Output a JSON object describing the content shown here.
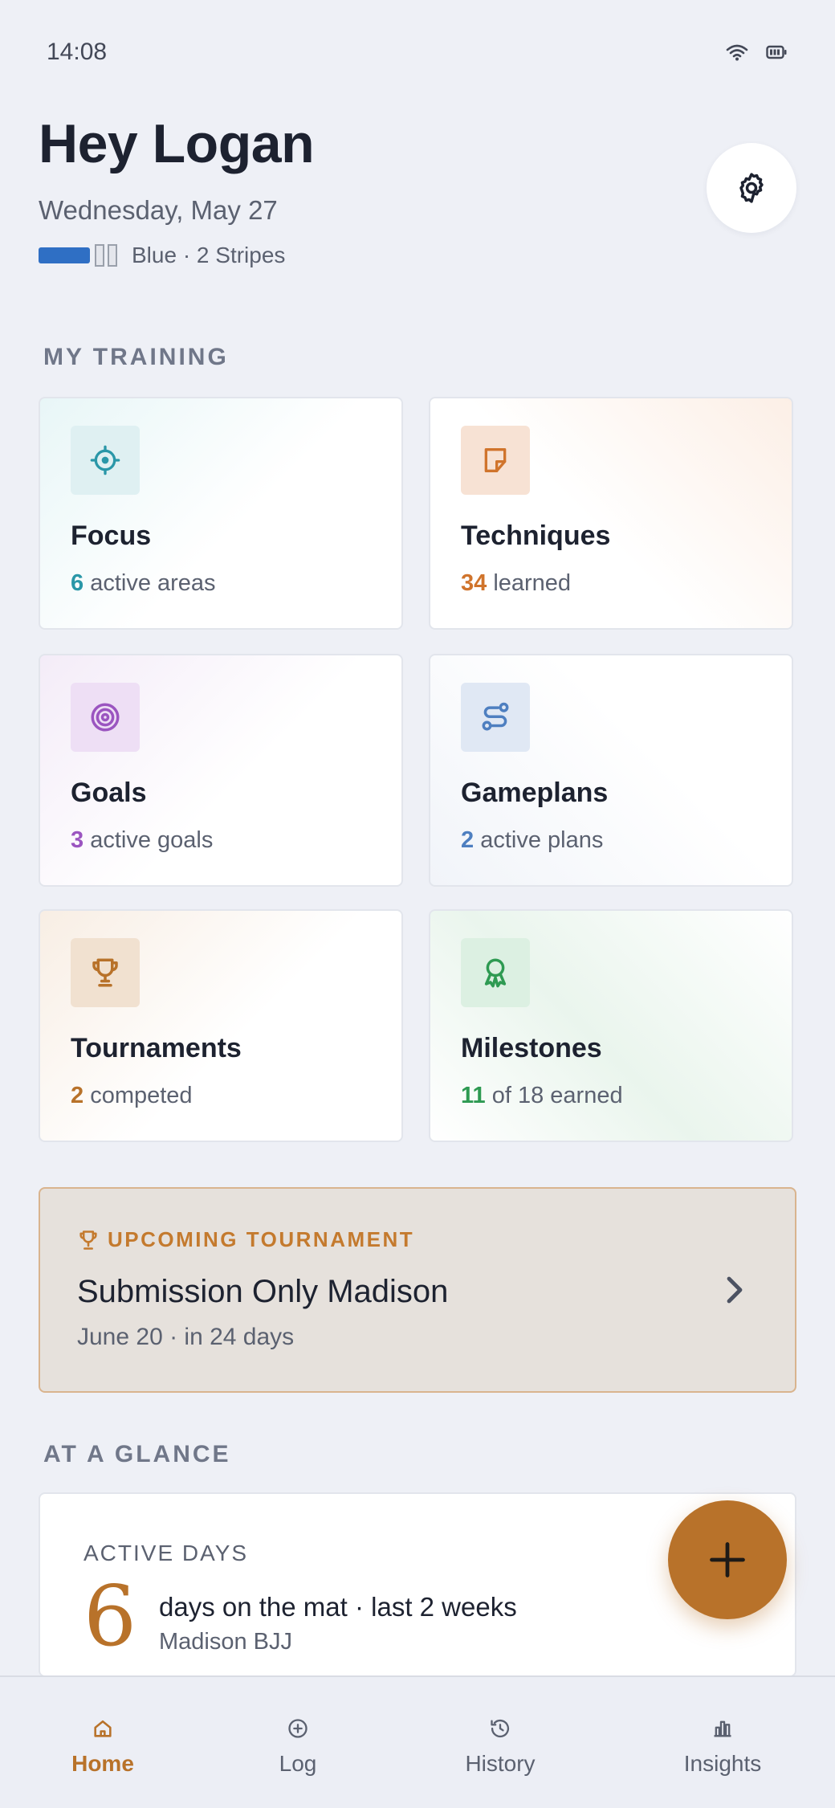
{
  "status": {
    "time": "14:08"
  },
  "header": {
    "greeting": "Hey Logan",
    "date": "Wednesday, May 27",
    "belt_text": "Blue · 2 Stripes"
  },
  "sections": {
    "training_title": "MY TRAINING",
    "glance_title": "AT A GLANCE"
  },
  "cards": [
    {
      "title": "Focus",
      "count": "6",
      "rest": " active areas",
      "accent": "#2a97a8",
      "icon": "crosshair-icon"
    },
    {
      "title": "Techniques",
      "count": "34",
      "rest": " learned",
      "accent": "#d0742c",
      "icon": "sticky-note-icon"
    },
    {
      "title": "Goals",
      "count": "3",
      "rest": " active goals",
      "accent": "#9b55c0",
      "icon": "target-icon"
    },
    {
      "title": "Gameplans",
      "count": "2",
      "rest": " active plans",
      "accent": "#4e7fc0",
      "icon": "route-icon"
    },
    {
      "title": "Tournaments",
      "count": "2",
      "rest": " competed",
      "accent": "#b8722a",
      "icon": "trophy-icon"
    },
    {
      "title": "Milestones",
      "count": "11",
      "rest": " of 18 earned",
      "accent": "#2e9a52",
      "icon": "award-icon"
    }
  ],
  "tournament": {
    "kicker": "UPCOMING TOURNAMENT",
    "name": "Submission Only Madison",
    "date": "June 20 · in 24 days"
  },
  "glance": {
    "label": "ACTIVE DAYS",
    "number": "6",
    "text": "days on the mat · last 2 weeks",
    "sub": "Madison BJJ"
  },
  "tabs": [
    {
      "label": "Home",
      "icon": "home-icon",
      "active": true
    },
    {
      "label": "Log",
      "icon": "plus-circle-icon",
      "active": false
    },
    {
      "label": "History",
      "icon": "history-icon",
      "active": false
    },
    {
      "label": "Insights",
      "icon": "bar-chart-icon",
      "active": false
    }
  ],
  "colors": {
    "accent": "#b8722a",
    "background": "#eef0f6",
    "belt": "#2f6fc4"
  }
}
